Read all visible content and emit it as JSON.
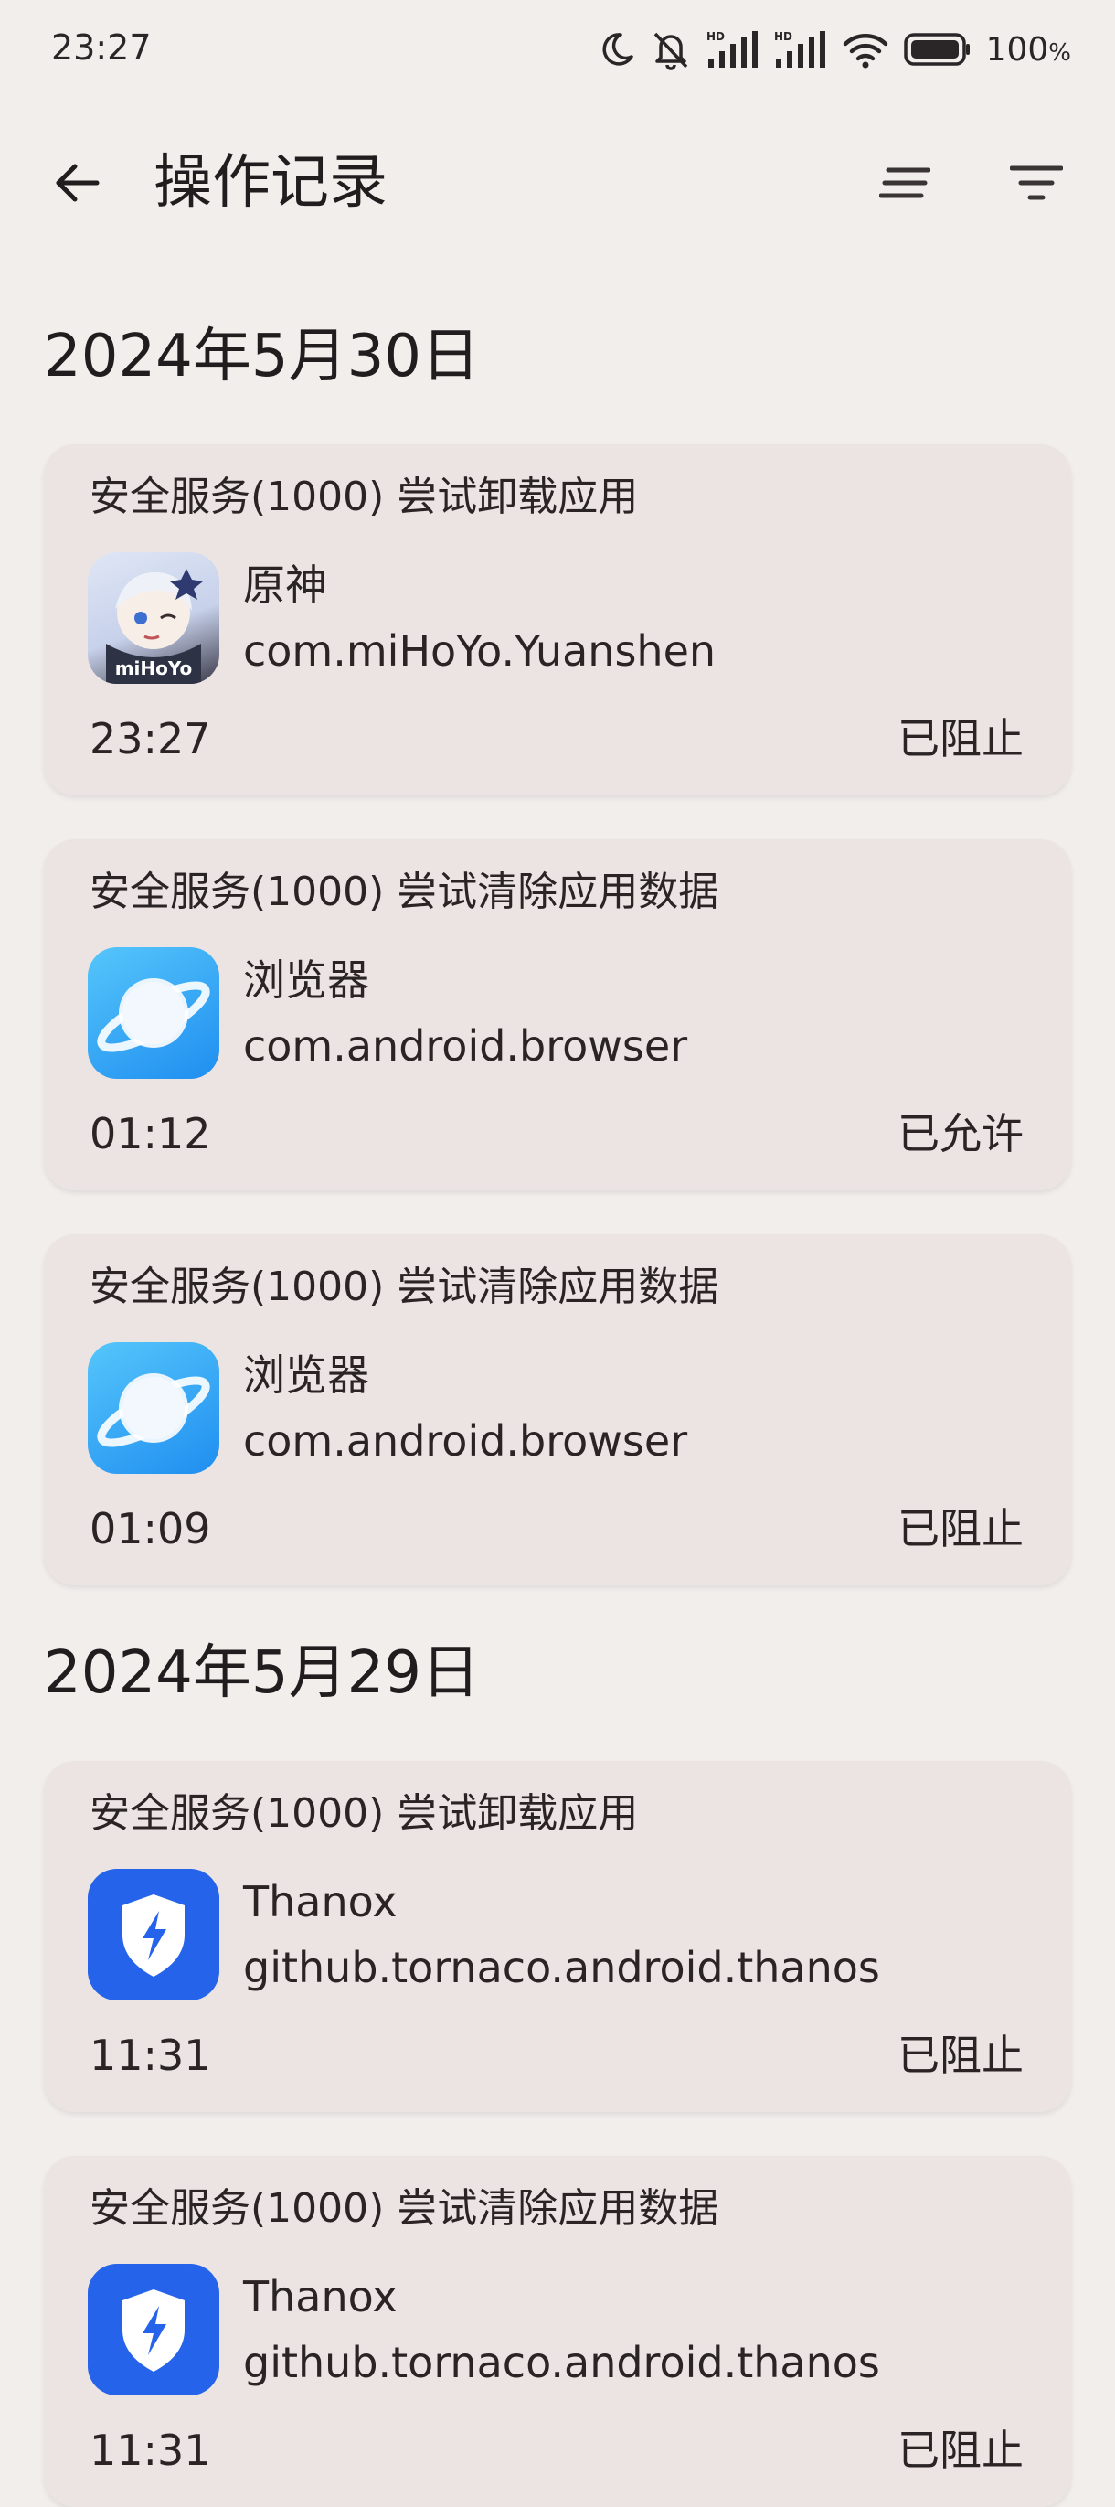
{
  "status_bar": {
    "time": "23:27",
    "battery": "100",
    "battery_unit": "%",
    "icons": [
      "moon-icon",
      "mute-icon",
      "hd-signal-icon",
      "hd-signal-icon",
      "wifi-icon",
      "battery-icon"
    ]
  },
  "app_bar": {
    "title": "操作记录",
    "back_icon": "arrow-left-icon",
    "sort_icon": "sort-icon",
    "filter_icon": "filter-icon"
  },
  "sections": [
    {
      "date": "2024年5月30日",
      "records": [
        {
          "operation": "安全服务(1000) 尝试卸载应用",
          "app_name": "原神",
          "package": "com.miHoYo.Yuanshen",
          "time": "23:27",
          "result": "已阻止",
          "icon": "genshin-app-icon",
          "icon_label": "miHoYo"
        },
        {
          "operation": "安全服务(1000) 尝试清除应用数据",
          "app_name": "浏览器",
          "package": "com.android.browser",
          "time": "01:12",
          "result": "已允许",
          "icon": "browser-app-icon"
        },
        {
          "operation": "安全服务(1000) 尝试清除应用数据",
          "app_name": "浏览器",
          "package": "com.android.browser",
          "time": "01:09",
          "result": "已阻止",
          "icon": "browser-app-icon"
        }
      ]
    },
    {
      "date": "2024年5月29日",
      "records": [
        {
          "operation": "安全服务(1000) 尝试卸载应用",
          "app_name": "Thanox",
          "package": "github.tornaco.android.thanos",
          "time": "11:31",
          "result": "已阻止",
          "icon": "thanox-app-icon"
        },
        {
          "operation": "安全服务(1000) 尝试清除应用数据",
          "app_name": "Thanox",
          "package": "github.tornaco.android.thanos",
          "time": "11:31",
          "result": "已阻止",
          "icon": "thanox-app-icon"
        }
      ]
    }
  ],
  "colors": {
    "background": "#f2eeec",
    "card": "#ebe4e3",
    "text": "#211c1d",
    "browser_icon": "#1f8ef0",
    "thanox_icon": "#2563ea"
  }
}
